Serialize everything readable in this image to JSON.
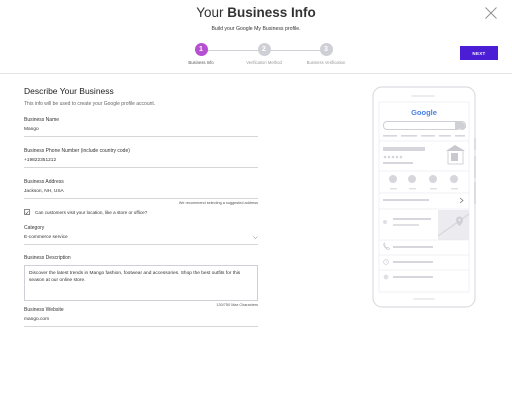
{
  "header": {
    "title_prefix": "Your",
    "title_bold": "Business Info",
    "subtitle": "Build your Google My Business profile."
  },
  "stepper": {
    "steps": [
      {
        "number": "1",
        "label": "Business Info",
        "state": "active"
      },
      {
        "number": "2",
        "label": "Verification Method",
        "state": "inactive"
      },
      {
        "number": "3",
        "label": "Business Verification",
        "state": "inactive"
      }
    ]
  },
  "actions": {
    "next_label": "NEXT"
  },
  "colors": {
    "accent_purple": "#b64fd1",
    "button_blue": "#4b1ed6",
    "inactive_gray": "#cfcfd6"
  },
  "form": {
    "section_title": "Describe Your Business",
    "section_desc": "This info will be used to create your Google profile account.",
    "business_name": {
      "label": "Business Name",
      "value": "Mango"
    },
    "phone": {
      "label": "Business Phone Number (include country code)",
      "value": "+19822351212"
    },
    "address": {
      "label": "Business Address",
      "value": "Jackson, NH, USA",
      "hint": "We recommend selecting a suggested address"
    },
    "visit_checkbox": {
      "label": "Can customers visit your location, like a store or office?",
      "checked": true
    },
    "category": {
      "label": "Category",
      "value": "E-commerce service"
    },
    "description": {
      "label": "Business Description",
      "value": "Discover the latest trends in Mango fashion, footwear and accessories. Shop the best outfits for this season at our online store.",
      "counter": "130/750 Max Characters"
    },
    "website": {
      "label": "Business Website",
      "value": "mango.com"
    }
  },
  "preview": {
    "logo_text": "Google"
  },
  "icons": [
    "close-icon",
    "check-icon",
    "chevron-down-icon",
    "search-icon",
    "phone-icon",
    "location-icon",
    "globe-icon"
  ]
}
